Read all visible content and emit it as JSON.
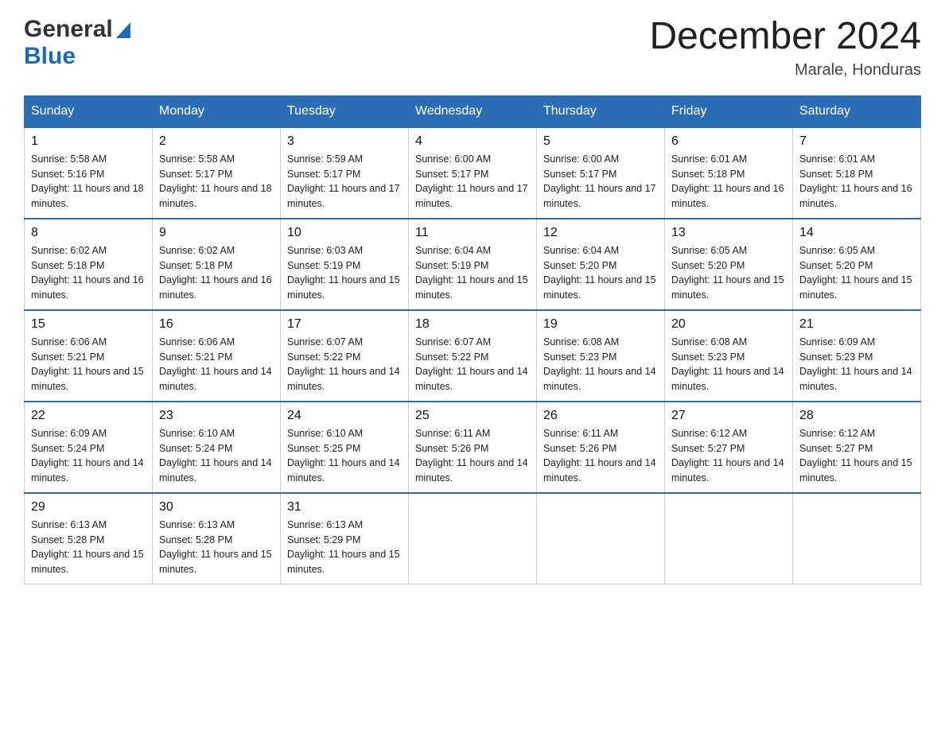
{
  "header": {
    "logo_general": "General",
    "logo_blue": "Blue",
    "month_title": "December 2024",
    "location": "Marale, Honduras"
  },
  "days_of_week": [
    "Sunday",
    "Monday",
    "Tuesday",
    "Wednesday",
    "Thursday",
    "Friday",
    "Saturday"
  ],
  "weeks": [
    [
      {
        "day": "1",
        "sunrise": "Sunrise: 5:58 AM",
        "sunset": "Sunset: 5:16 PM",
        "daylight": "Daylight: 11 hours and 18 minutes."
      },
      {
        "day": "2",
        "sunrise": "Sunrise: 5:58 AM",
        "sunset": "Sunset: 5:17 PM",
        "daylight": "Daylight: 11 hours and 18 minutes."
      },
      {
        "day": "3",
        "sunrise": "Sunrise: 5:59 AM",
        "sunset": "Sunset: 5:17 PM",
        "daylight": "Daylight: 11 hours and 17 minutes."
      },
      {
        "day": "4",
        "sunrise": "Sunrise: 6:00 AM",
        "sunset": "Sunset: 5:17 PM",
        "daylight": "Daylight: 11 hours and 17 minutes."
      },
      {
        "day": "5",
        "sunrise": "Sunrise: 6:00 AM",
        "sunset": "Sunset: 5:17 PM",
        "daylight": "Daylight: 11 hours and 17 minutes."
      },
      {
        "day": "6",
        "sunrise": "Sunrise: 6:01 AM",
        "sunset": "Sunset: 5:18 PM",
        "daylight": "Daylight: 11 hours and 16 minutes."
      },
      {
        "day": "7",
        "sunrise": "Sunrise: 6:01 AM",
        "sunset": "Sunset: 5:18 PM",
        "daylight": "Daylight: 11 hours and 16 minutes."
      }
    ],
    [
      {
        "day": "8",
        "sunrise": "Sunrise: 6:02 AM",
        "sunset": "Sunset: 5:18 PM",
        "daylight": "Daylight: 11 hours and 16 minutes."
      },
      {
        "day": "9",
        "sunrise": "Sunrise: 6:02 AM",
        "sunset": "Sunset: 5:18 PM",
        "daylight": "Daylight: 11 hours and 16 minutes."
      },
      {
        "day": "10",
        "sunrise": "Sunrise: 6:03 AM",
        "sunset": "Sunset: 5:19 PM",
        "daylight": "Daylight: 11 hours and 15 minutes."
      },
      {
        "day": "11",
        "sunrise": "Sunrise: 6:04 AM",
        "sunset": "Sunset: 5:19 PM",
        "daylight": "Daylight: 11 hours and 15 minutes."
      },
      {
        "day": "12",
        "sunrise": "Sunrise: 6:04 AM",
        "sunset": "Sunset: 5:20 PM",
        "daylight": "Daylight: 11 hours and 15 minutes."
      },
      {
        "day": "13",
        "sunrise": "Sunrise: 6:05 AM",
        "sunset": "Sunset: 5:20 PM",
        "daylight": "Daylight: 11 hours and 15 minutes."
      },
      {
        "day": "14",
        "sunrise": "Sunrise: 6:05 AM",
        "sunset": "Sunset: 5:20 PM",
        "daylight": "Daylight: 11 hours and 15 minutes."
      }
    ],
    [
      {
        "day": "15",
        "sunrise": "Sunrise: 6:06 AM",
        "sunset": "Sunset: 5:21 PM",
        "daylight": "Daylight: 11 hours and 15 minutes."
      },
      {
        "day": "16",
        "sunrise": "Sunrise: 6:06 AM",
        "sunset": "Sunset: 5:21 PM",
        "daylight": "Daylight: 11 hours and 14 minutes."
      },
      {
        "day": "17",
        "sunrise": "Sunrise: 6:07 AM",
        "sunset": "Sunset: 5:22 PM",
        "daylight": "Daylight: 11 hours and 14 minutes."
      },
      {
        "day": "18",
        "sunrise": "Sunrise: 6:07 AM",
        "sunset": "Sunset: 5:22 PM",
        "daylight": "Daylight: 11 hours and 14 minutes."
      },
      {
        "day": "19",
        "sunrise": "Sunrise: 6:08 AM",
        "sunset": "Sunset: 5:23 PM",
        "daylight": "Daylight: 11 hours and 14 minutes."
      },
      {
        "day": "20",
        "sunrise": "Sunrise: 6:08 AM",
        "sunset": "Sunset: 5:23 PM",
        "daylight": "Daylight: 11 hours and 14 minutes."
      },
      {
        "day": "21",
        "sunrise": "Sunrise: 6:09 AM",
        "sunset": "Sunset: 5:23 PM",
        "daylight": "Daylight: 11 hours and 14 minutes."
      }
    ],
    [
      {
        "day": "22",
        "sunrise": "Sunrise: 6:09 AM",
        "sunset": "Sunset: 5:24 PM",
        "daylight": "Daylight: 11 hours and 14 minutes."
      },
      {
        "day": "23",
        "sunrise": "Sunrise: 6:10 AM",
        "sunset": "Sunset: 5:24 PM",
        "daylight": "Daylight: 11 hours and 14 minutes."
      },
      {
        "day": "24",
        "sunrise": "Sunrise: 6:10 AM",
        "sunset": "Sunset: 5:25 PM",
        "daylight": "Daylight: 11 hours and 14 minutes."
      },
      {
        "day": "25",
        "sunrise": "Sunrise: 6:11 AM",
        "sunset": "Sunset: 5:26 PM",
        "daylight": "Daylight: 11 hours and 14 minutes."
      },
      {
        "day": "26",
        "sunrise": "Sunrise: 6:11 AM",
        "sunset": "Sunset: 5:26 PM",
        "daylight": "Daylight: 11 hours and 14 minutes."
      },
      {
        "day": "27",
        "sunrise": "Sunrise: 6:12 AM",
        "sunset": "Sunset: 5:27 PM",
        "daylight": "Daylight: 11 hours and 14 minutes."
      },
      {
        "day": "28",
        "sunrise": "Sunrise: 6:12 AM",
        "sunset": "Sunset: 5:27 PM",
        "daylight": "Daylight: 11 hours and 15 minutes."
      }
    ],
    [
      {
        "day": "29",
        "sunrise": "Sunrise: 6:13 AM",
        "sunset": "Sunset: 5:28 PM",
        "daylight": "Daylight: 11 hours and 15 minutes."
      },
      {
        "day": "30",
        "sunrise": "Sunrise: 6:13 AM",
        "sunset": "Sunset: 5:28 PM",
        "daylight": "Daylight: 11 hours and 15 minutes."
      },
      {
        "day": "31",
        "sunrise": "Sunrise: 6:13 AM",
        "sunset": "Sunset: 5:29 PM",
        "daylight": "Daylight: 11 hours and 15 minutes."
      },
      null,
      null,
      null,
      null
    ]
  ]
}
